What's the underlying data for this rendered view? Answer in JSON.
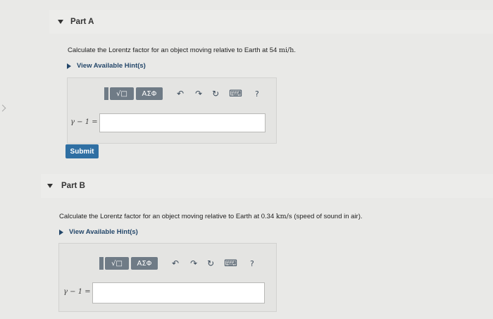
{
  "partA": {
    "title": "Part A",
    "question_prefix": "Calculate the Lorentz factor for an object moving relative to Earth at 54 ",
    "question_unit": "mi/h",
    "question_suffix": ".",
    "hint_label": "View Available Hint(s)",
    "toolbar": {
      "templates_label": "√□",
      "greek_label": "ΑΣΦ",
      "help_label": "?"
    },
    "input_label": "γ − 1 =",
    "input_value": "",
    "submit_label": "Submit"
  },
  "partB": {
    "title": "Part B",
    "question_prefix": "Calculate the Lorentz factor for an object moving relative to Earth at 0.34 ",
    "question_unit": "km/s",
    "question_suffix": " (speed of sound in air).",
    "hint_label": "View Available Hint(s)",
    "toolbar": {
      "templates_label": "√□",
      "greek_label": "ΑΣΦ",
      "help_label": "?"
    },
    "input_label": "γ − 1 =",
    "input_value": ""
  },
  "icons": {
    "undo": "↶",
    "redo": "↷",
    "reset": "↻",
    "keyboard": "⌨",
    "caret_down": "caret-down-icon",
    "caret_right": "caret-right-icon"
  },
  "colors": {
    "hint": "#24476a",
    "submit": "#2f6fa3",
    "toolbar_button": "#6f7b86"
  }
}
